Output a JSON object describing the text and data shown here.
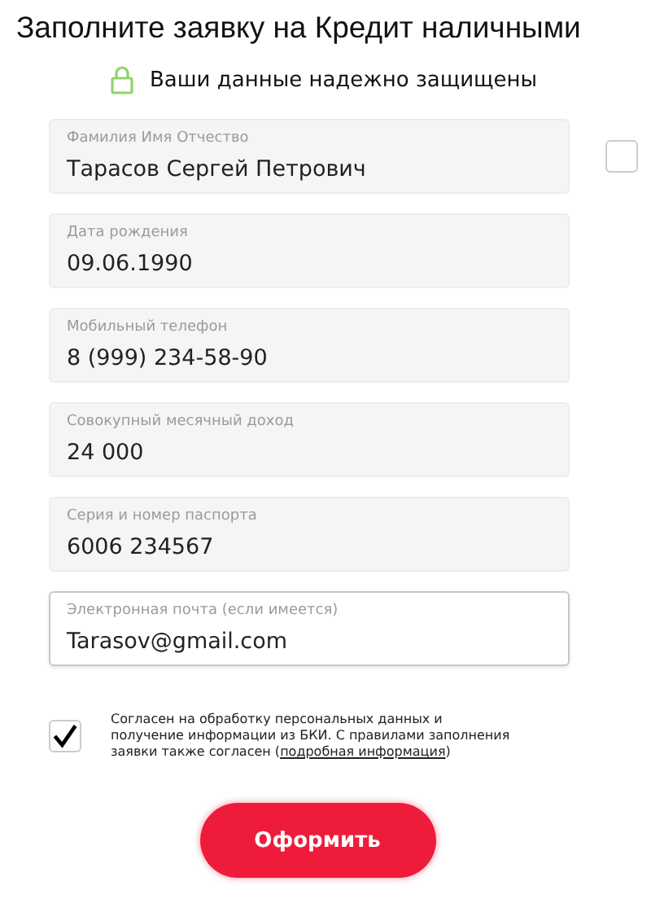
{
  "title": "Заполните заявку на Кредит наличными",
  "secure_note": "Ваши данные надежно защищены",
  "fields": [
    {
      "label": "Фамилия Имя Отчество",
      "value": "Тарасов Сергей Петрович",
      "focused": false,
      "side_checkbox": {
        "checked": false
      }
    },
    {
      "label": "Дата рождения",
      "value": "09.06.1990",
      "focused": false
    },
    {
      "label": "Мобильный телефон",
      "value": "8 (999) 234-58-90",
      "focused": false
    },
    {
      "label": "Совокупный месячный доход",
      "value": "24 000",
      "focused": false
    },
    {
      "label": "Серия и номер паспорта",
      "value": "6006 234567",
      "focused": false
    },
    {
      "label": "Электронная почта (если имеется)",
      "value": "Tarasov@gmail.com",
      "focused": true
    }
  ],
  "consent": {
    "checked": true,
    "text": "Согласен на обработку персональных данных и получение информации из БКИ. С правилами заполнения заявки также согласен (",
    "link": "подробная информация",
    "text_after": ")"
  },
  "submit_button": "Оформить"
}
